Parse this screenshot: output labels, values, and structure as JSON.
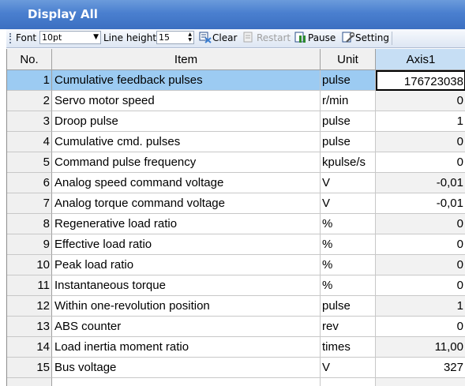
{
  "window": {
    "title": "Display All"
  },
  "toolbar": {
    "font_label": "Font",
    "font_value": "10pt",
    "line_height_label": "Line height",
    "line_height_value": "15",
    "clear_label": "Clear",
    "restart_label": "Restart",
    "pause_label": "Pause",
    "setting_label": "Setting"
  },
  "table": {
    "columns": {
      "no": "No.",
      "item": "Item",
      "unit": "Unit",
      "axis": "Axis1"
    },
    "rows": [
      {
        "no": "1",
        "item": "Cumulative feedback pulses",
        "unit": "pulse",
        "value": "176723038"
      },
      {
        "no": "2",
        "item": "Servo motor speed",
        "unit": "r/min",
        "value": "0"
      },
      {
        "no": "3",
        "item": "Droop pulse",
        "unit": "pulse",
        "value": "1"
      },
      {
        "no": "4",
        "item": "Cumulative cmd. pulses",
        "unit": "pulse",
        "value": "0"
      },
      {
        "no": "5",
        "item": "Command pulse frequency",
        "unit": "kpulse/s",
        "value": "0"
      },
      {
        "no": "6",
        "item": "Analog speed command voltage",
        "unit": "V",
        "value": "-0,01"
      },
      {
        "no": "7",
        "item": "Analog torque command voltage",
        "unit": "V",
        "value": "-0,01"
      },
      {
        "no": "8",
        "item": "Regenerative load ratio",
        "unit": "%",
        "value": "0"
      },
      {
        "no": "9",
        "item": "Effective load ratio",
        "unit": "%",
        "value": "0"
      },
      {
        "no": "10",
        "item": "Peak load ratio",
        "unit": "%",
        "value": "0"
      },
      {
        "no": "11",
        "item": "Instantaneous torque",
        "unit": "%",
        "value": "0"
      },
      {
        "no": "12",
        "item": "Within one-revolution position",
        "unit": "pulse",
        "value": "1"
      },
      {
        "no": "13",
        "item": "ABS counter",
        "unit": "rev",
        "value": "0"
      },
      {
        "no": "14",
        "item": "Load inertia moment ratio",
        "unit": "times",
        "value": "11,00"
      },
      {
        "no": "15",
        "item": "Bus voltage",
        "unit": "V",
        "value": "327"
      }
    ]
  },
  "colors": {
    "title_bar": "#4a7fcf",
    "selection": "#9ccbf2",
    "axis_header": "#c6def4"
  }
}
